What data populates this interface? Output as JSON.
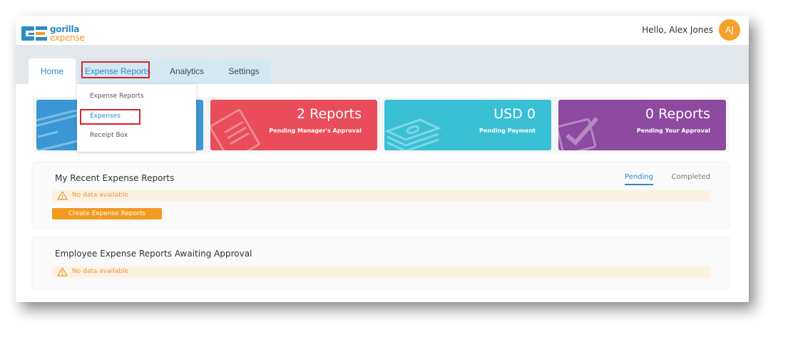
{
  "header": {
    "logo_gorilla": "gorilla",
    "logo_expense": "expense",
    "greeting": "Hello, Alex Jones",
    "avatar_initials": "AJ"
  },
  "nav": {
    "tabs": [
      {
        "label": "Home"
      },
      {
        "label": "Expense Reports"
      },
      {
        "label": "Analytics"
      },
      {
        "label": "Settings"
      }
    ]
  },
  "dropdown": {
    "items": [
      {
        "label": "Expense Reports"
      },
      {
        "label": "Expenses"
      },
      {
        "label": "Receipt Box"
      }
    ]
  },
  "cards": [
    {
      "value": "",
      "label": "",
      "color": "#3b97d3",
      "icon": "credit-card-icon"
    },
    {
      "value": "2 Reports",
      "label": "Pending Manager's Approval",
      "color": "#e94d5a",
      "icon": "document-icon"
    },
    {
      "value": "USD 0",
      "label": "Pending Payment",
      "color": "#3ac0d4",
      "icon": "money-stack-icon"
    },
    {
      "value": "0 Reports",
      "label": "Pending Your Approval",
      "color": "#8d4aa0",
      "icon": "checkbox-icon"
    }
  ],
  "recent": {
    "title": "My Recent Expense Reports",
    "tab_pending": "Pending",
    "tab_completed": "Completed",
    "no_data": "No data available",
    "create_button": "Create Expense Reports"
  },
  "awaiting": {
    "title": "Employee Expense Reports Awaiting Approval",
    "no_data": "No data available"
  },
  "colors": {
    "brand_blue": "#2a8bc9",
    "brand_orange": "#f29a1e",
    "highlight_red": "#d7262a"
  }
}
